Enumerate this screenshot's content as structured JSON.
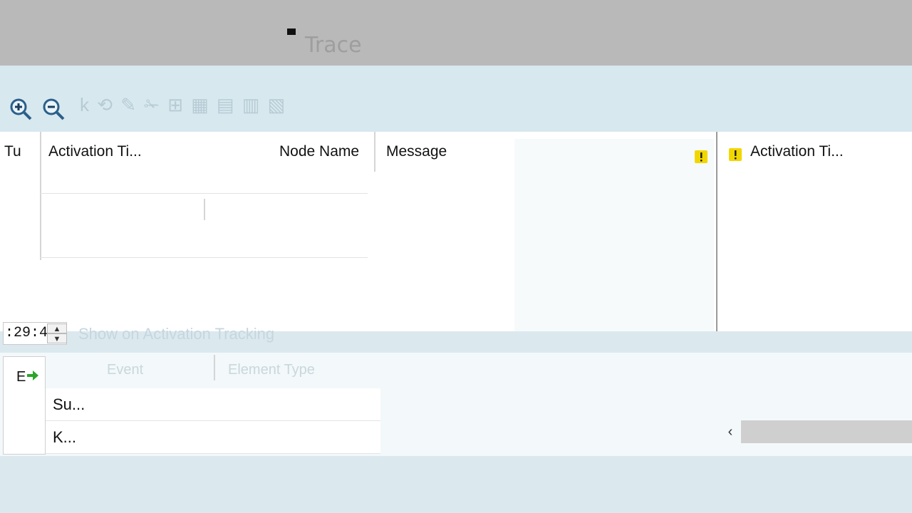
{
  "window": {
    "title": "Trace"
  },
  "toolbar": {
    "zoom_in": "zoom-in-icon",
    "zoom_out": "zoom-out-icon",
    "faded_text": "k ⟲ ✎ ✁ ⊞ ▦ ▤ ▥ ▧"
  },
  "grid": {
    "columns": [
      {
        "label": "Tu"
      },
      {
        "label": "Activation Ti..."
      },
      {
        "label": "Node Name"
      },
      {
        "label": "Message"
      },
      {
        "label": "Activation Ti..."
      }
    ]
  },
  "time_filter": {
    "value": ":29:4"
  },
  "faint": {
    "filter_label": "Show on Activation Tracking",
    "col1": "Event",
    "col2": "Element Type"
  },
  "bottom_rows": [
    {
      "label": "Su..."
    },
    {
      "label": "K..."
    }
  ],
  "colors": {
    "titlebar": "#b9b9b9",
    "toolbar": "#d8e8ef",
    "warning": "#f2d600",
    "event_arrow": "#2aa52a"
  }
}
